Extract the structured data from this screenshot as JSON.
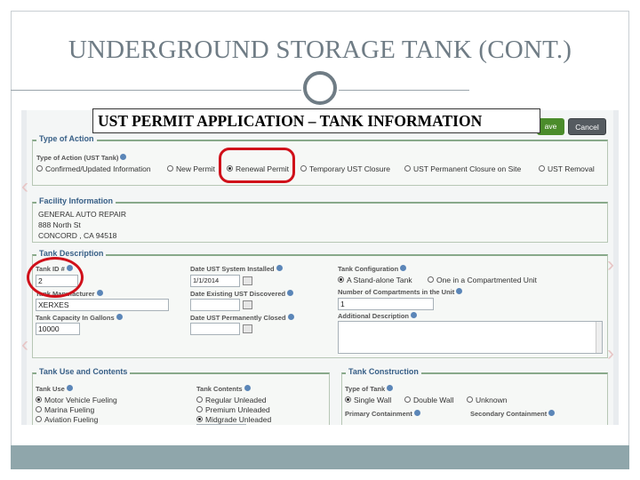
{
  "slide": {
    "title": "UNDERGROUND STORAGE TANK (CONT.)",
    "callout": "UST PERMIT APPLICATION – TANK INFORMATION"
  },
  "toolbar": {
    "save_label": "ave",
    "cancel_label": "Cancel"
  },
  "type_of_action": {
    "legend": "Type of Action",
    "label": "Type of Action (UST Tank)",
    "options": [
      "Confirmed/Updated Information",
      "New Permit",
      "Renewal Permit",
      "Temporary UST Closure",
      "UST Permanent Closure on Site",
      "UST Removal"
    ],
    "selected": "Renewal Permit"
  },
  "facility": {
    "legend": "Facility Information",
    "name": "GENERAL AUTO REPAIR",
    "street": "888 North St",
    "city": "CONCORD",
    "sep": ",",
    "state": "CA",
    "zip": "94518"
  },
  "tank_description": {
    "legend": "Tank Description",
    "tank_id_label": "Tank ID #",
    "tank_id_value": "2",
    "manufacturer_label": "Tank Manufacturer",
    "manufacturer_value": "XERXES",
    "capacity_label": "Tank Capacity In Gallons",
    "capacity_value": "10000",
    "date_installed_label": "Date UST System Installed",
    "date_installed_value": "1/1/2014",
    "date_discovered_label": "Date Existing UST Discovered",
    "date_discovered_value": "",
    "date_closed_label": "Date UST Permanently Closed",
    "date_closed_value": "",
    "config_label": "Tank Configuration",
    "config_options": [
      "A Stand-alone Tank",
      "One in a Compartmented Unit"
    ],
    "config_selected": "A Stand-alone Tank",
    "compartments_label": "Number of Compartments in the Unit",
    "compartments_value": "1",
    "additional_label": "Additional Description"
  },
  "tank_use": {
    "legend": "Tank Use and Contents",
    "use_label": "Tank Use",
    "use_options": [
      "Motor Vehicle Fueling",
      "Marina Fueling",
      "Aviation Fueling"
    ],
    "use_selected": "Motor Vehicle Fueling",
    "contents_label": "Tank Contents",
    "contents_options": [
      "Regular Unleaded",
      "Premium Unleaded",
      "Midgrade Unleaded"
    ],
    "contents_selected": "Midgrade Unleaded"
  },
  "tank_construction": {
    "legend": "Tank Construction",
    "type_label": "Type of Tank",
    "type_options": [
      "Single Wall",
      "Double Wall",
      "Unknown"
    ],
    "type_selected": "Single Wall",
    "primary_label": "Primary Containment",
    "secondary_label": "Secondary Containment"
  },
  "icons": [
    "help-icon",
    "calendar-icon",
    "radio-icon"
  ],
  "colors": {
    "highlight": "#d0101a",
    "legend_text": "#375f86",
    "save": "#4b8c2b",
    "footer": "#8fa6ab",
    "title": "#6f7c85"
  }
}
